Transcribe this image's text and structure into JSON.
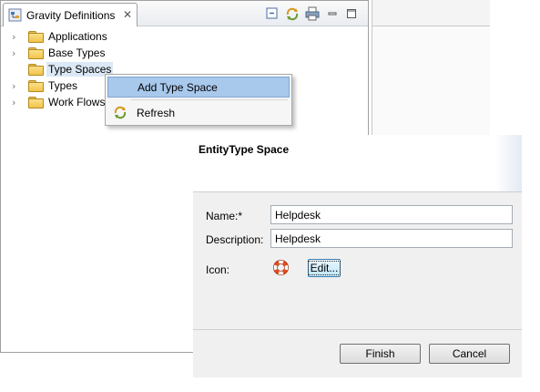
{
  "view": {
    "tab_title": "Gravity Definitions",
    "toolbar": {
      "collapse_icon": "collapse-all-icon",
      "sync_icon": "sync-icon",
      "print_icon": "print-icon",
      "minimize_icon": "minimize-icon",
      "maximize_icon": "maximize-icon"
    }
  },
  "tree": {
    "items": [
      {
        "label": "Applications"
      },
      {
        "label": "Base Types"
      },
      {
        "label": "Type Spaces",
        "selected": true
      },
      {
        "label": "Types"
      },
      {
        "label": "Work Flows"
      }
    ]
  },
  "context_menu": {
    "items": [
      {
        "label": "Add Type Space",
        "highlighted": true
      },
      {
        "label": "Refresh",
        "icon": "refresh-icon"
      }
    ]
  },
  "dialog": {
    "title": "EntityType Space",
    "name_label": "Name:*",
    "name_value": "Helpdesk",
    "description_label": "Description:",
    "description_value": "Helpdesk",
    "icon_label": "Icon:",
    "icon": "lifebuoy-icon",
    "edit_button": "Edit...",
    "finish_button": "Finish",
    "cancel_button": "Cancel"
  },
  "colors": {
    "selection": "#dbe8f6",
    "menu_highlight": "#a8c8ec",
    "dialog_bg": "#f0f0f0"
  }
}
